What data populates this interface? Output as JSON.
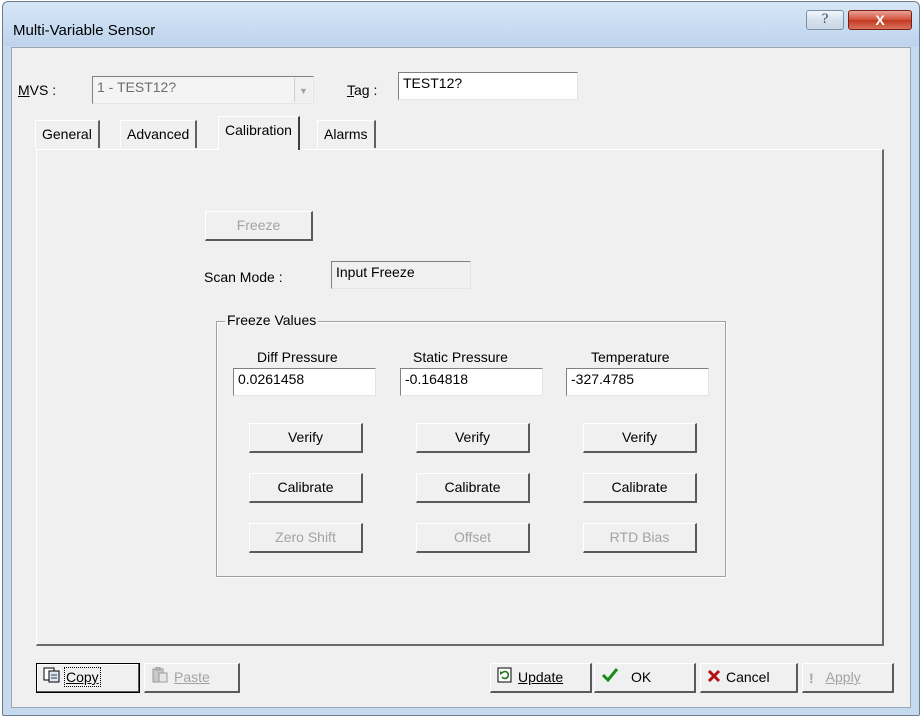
{
  "window": {
    "title": "Multi-Variable Sensor",
    "help_button": "?",
    "close_button": "X"
  },
  "header": {
    "mvs_label_u": "M",
    "mvs_label_rest": "VS :",
    "mvs_value": "1 - TEST12?",
    "tag_label_u": "T",
    "tag_label_rest": "ag :",
    "tag_value": "TEST12?"
  },
  "tabs": [
    {
      "label": "General"
    },
    {
      "label": "Advanced"
    },
    {
      "label": "Calibration",
      "active": true
    },
    {
      "label": "Alarms"
    }
  ],
  "calibration": {
    "freeze_button": "Freeze",
    "scan_mode_label": "Scan Mode :",
    "scan_mode_value": "Input Freeze",
    "freeze_values_title": "Freeze Values",
    "columns": [
      {
        "heading": "Diff Pressure",
        "value": "0.0261458",
        "verify": "Verify",
        "calibrate": "Calibrate",
        "extra": "Zero Shift"
      },
      {
        "heading": "Static Pressure",
        "value": "-0.164818",
        "verify": "Verify",
        "calibrate": "Calibrate",
        "extra": "Offset"
      },
      {
        "heading": "Temperature",
        "value": "-327.4785",
        "verify": "Verify",
        "calibrate": "Calibrate",
        "extra": "RTD Bias"
      }
    ]
  },
  "footer": {
    "copy_label": "Copy",
    "paste_label": "Paste",
    "update_label": "Update",
    "ok_label": "OK",
    "cancel_label": "Cancel",
    "apply_label": "Apply"
  },
  "colors": {
    "title_bg": "#c7dbf1",
    "dialog_bg": "#f0f0f0",
    "close_red": "#c2381f",
    "ok_check_green": "#1a8a1a",
    "cancel_x_red": "#b01010"
  }
}
